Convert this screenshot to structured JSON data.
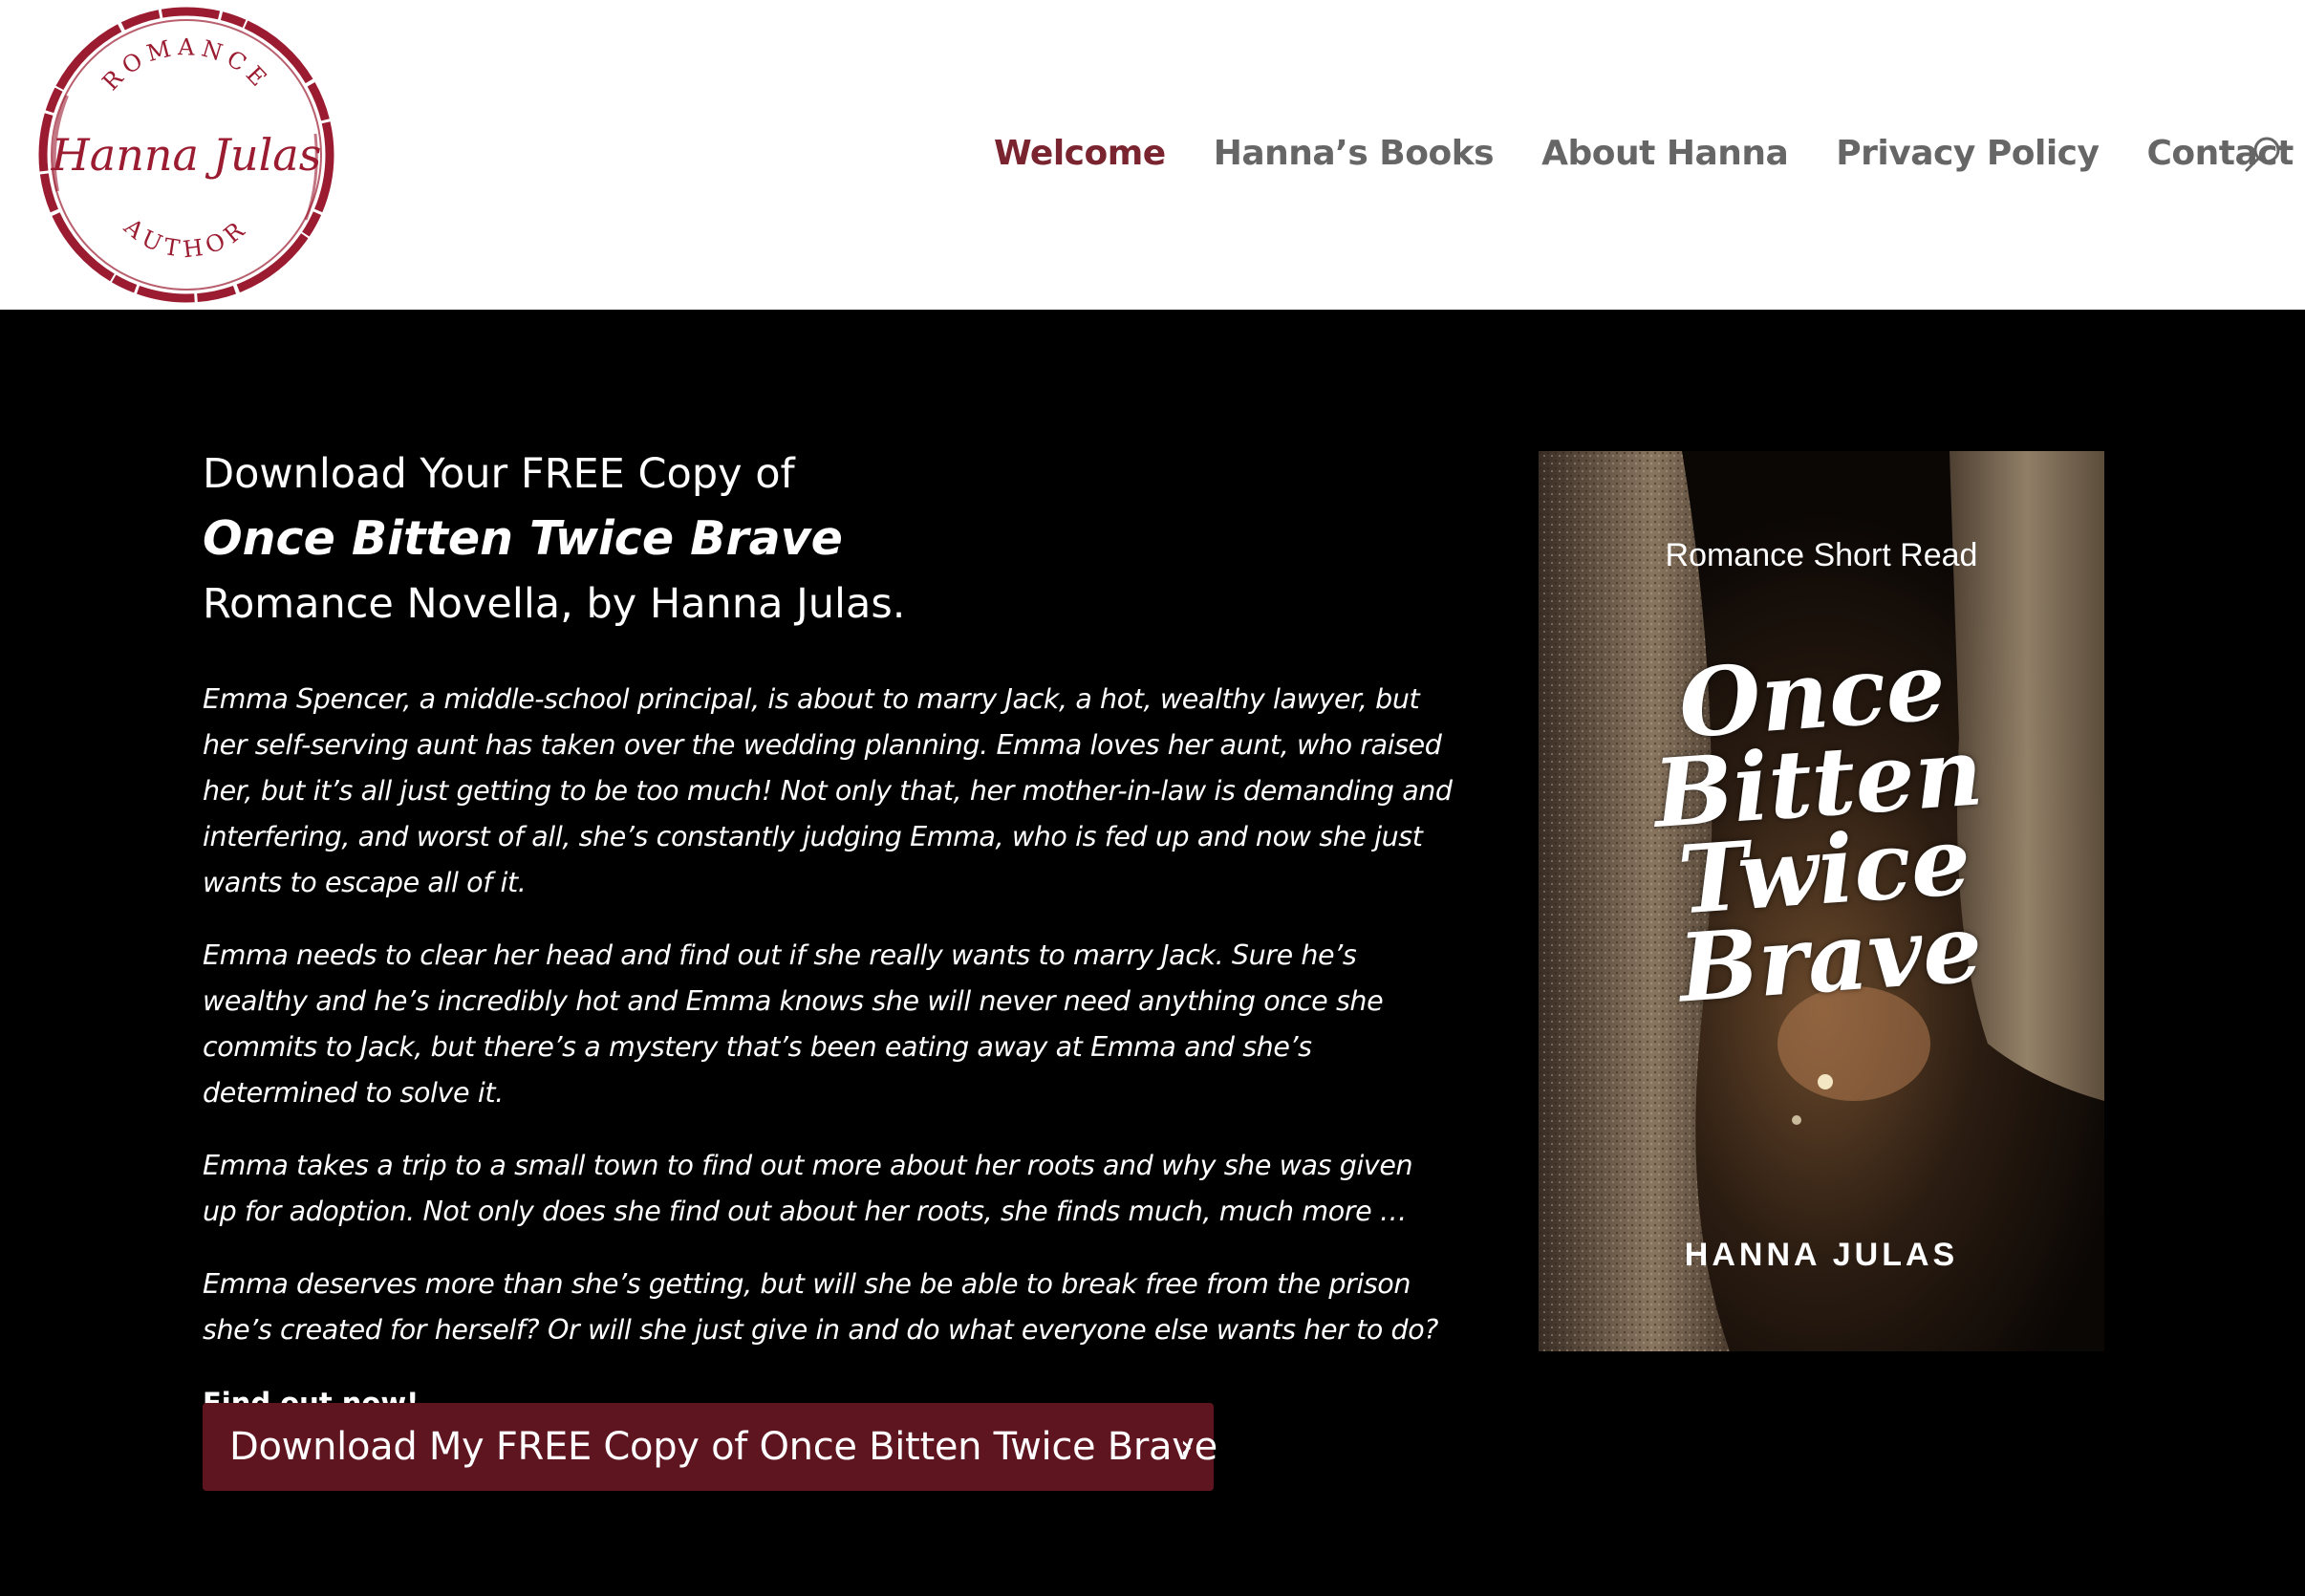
{
  "logo": {
    "top_text": "ROMANCE",
    "script_text": "Hanna Julas",
    "bottom_text": "AUTHOR"
  },
  "nav": {
    "items": [
      {
        "label": "Welcome",
        "active": true
      },
      {
        "label": "Hanna’s Books",
        "active": false
      },
      {
        "label": "About Hanna",
        "active": false
      },
      {
        "label": "Privacy Policy",
        "active": false
      },
      {
        "label": "Contact",
        "active": false
      }
    ],
    "search_icon": "search-icon"
  },
  "hero": {
    "line1": "Download Your FREE Copy of",
    "title": "Once Bitten Twice Brave",
    "line3": "Romance Novella, by Hanna Julas.",
    "paragraphs": [
      "Emma Spencer, a middle-school principal, is about to marry Jack, a hot, wealthy lawyer, but her self-serving aunt has taken over the wedding planning. Emma loves her aunt, who raised her, but it’s all just getting to be too much! Not only that, her mother-in-law is demanding and interfering, and worst of all, she’s constantly judging Emma, who is fed up and now she just wants to escape all of it.",
      "Emma needs to clear her head and find out if she really wants to marry Jack. Sure he’s wealthy and he’s incredibly hot and Emma knows she will never need anything once she commits to Jack, but there’s a mystery that’s been eating away at Emma and she’s determined to solve it.",
      "Emma takes a trip to a small town to find out more about her roots and why she was given up for adoption. Not only does she find out about her roots, she finds much, much more …",
      "Emma deserves more than she’s getting, but will she be able to break free from the prison she’s created for herself? Or will she just give in and do what everyone else wants her to do?"
    ],
    "cta_text": "Find out now!",
    "button_label": "Download My FREE Copy of Once Bitten Twice Brave",
    "button_icon": "chevron-right-icon"
  },
  "cover": {
    "subtitle": "Romance Short Read",
    "title_lines": [
      "Once",
      "Bitten",
      "Twice",
      "Brave"
    ],
    "author": "HANNA JULAS"
  },
  "colors": {
    "accent": "#7a2430",
    "button_bg": "#5e1520",
    "nav_text": "#666666",
    "background": "#000000"
  }
}
